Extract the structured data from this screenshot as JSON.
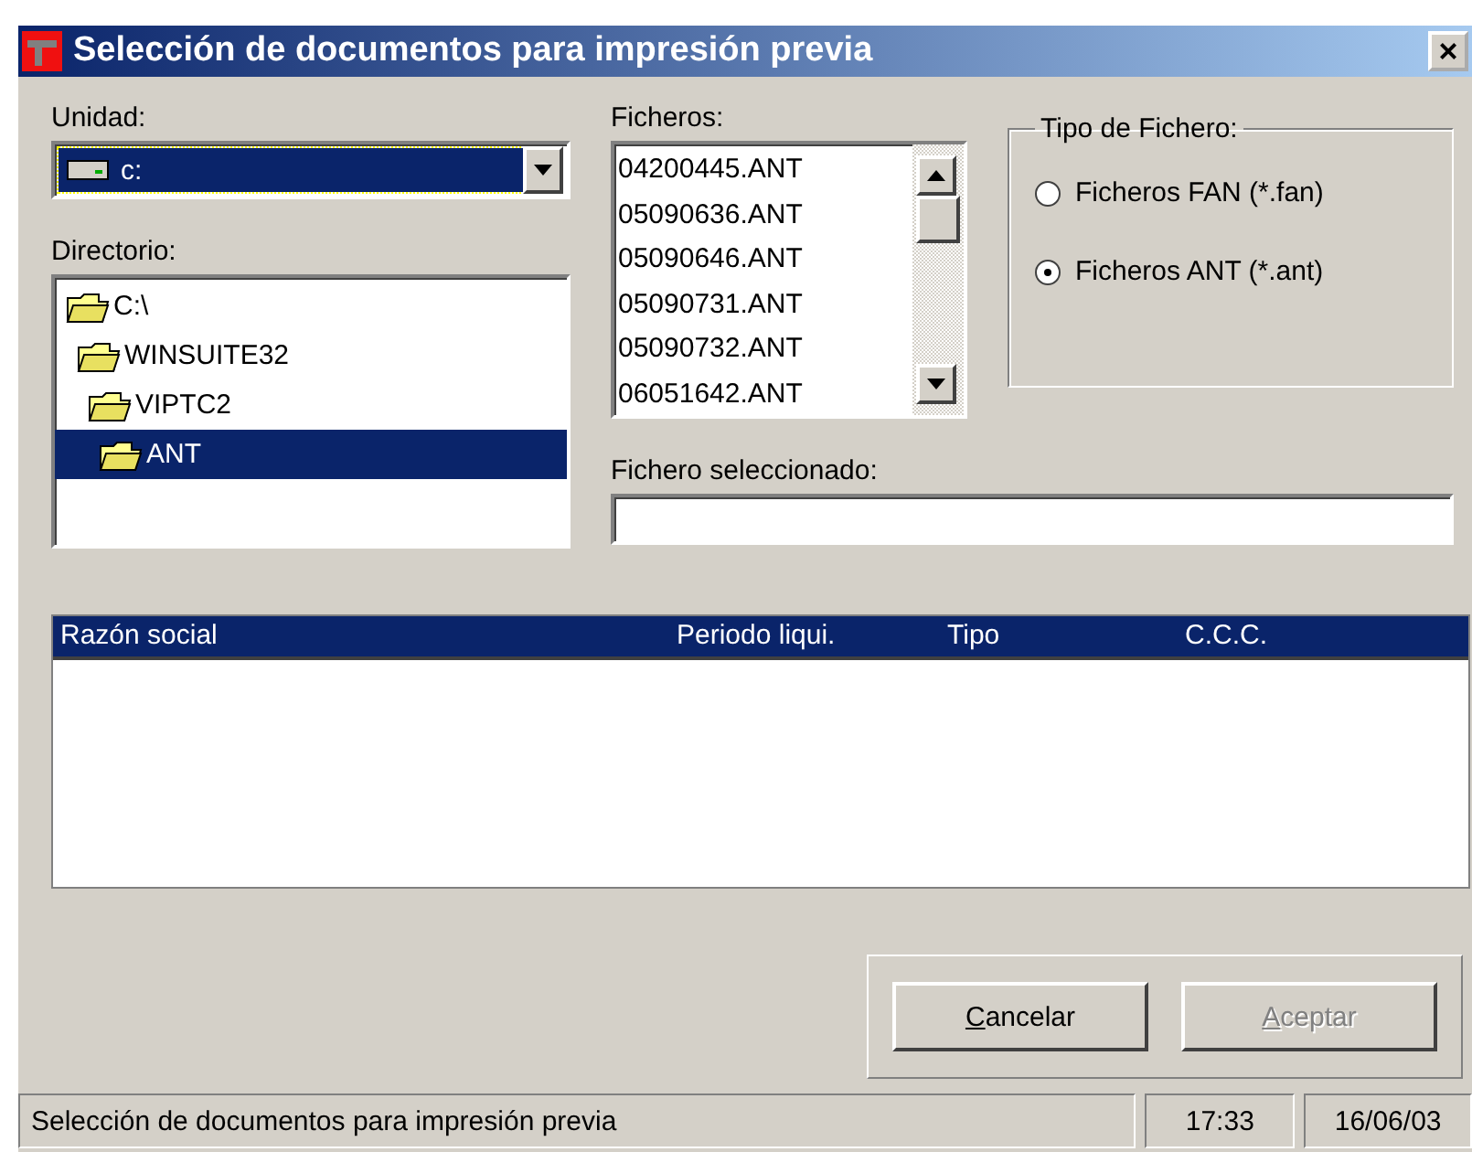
{
  "window": {
    "title": "Selección de documentos para impresión previa",
    "close": "×"
  },
  "drive": {
    "label": "Unidad:",
    "value": "c:",
    "selected": true
  },
  "directory": {
    "label": "Directorio:",
    "items": [
      {
        "name": "C:\\",
        "selected": false,
        "children": [
          {
            "name": "WINSUITE32",
            "selected": false,
            "children": [
              {
                "name": "VIPTC2",
                "selected": false,
                "children": [
                  {
                    "name": "ANT",
                    "selected": true
                  }
                ]
              }
            ]
          }
        ]
      }
    ]
  },
  "files": {
    "label": "Ficheros:",
    "items": [
      "04200445.ANT",
      "05090636.ANT",
      "05090646.ANT",
      "05090731.ANT",
      "05090732.ANT",
      "06051642.ANT"
    ]
  },
  "file_type": {
    "label": "Tipo de Fichero:",
    "options": [
      {
        "label": "Ficheros FAN (*.fan)",
        "selected": false
      },
      {
        "label": "Ficheros ANT (*.ant)",
        "selected": true
      }
    ]
  },
  "selected_file": {
    "label": "Fichero seleccionado:"
  },
  "table": {
    "columns": [
      "Razón social",
      "Periodo liqui.",
      "Tipo",
      "C.C.C."
    ]
  },
  "buttons": [
    {
      "label": "Cancelar",
      "disabled": false
    },
    {
      "label": "Aceptar",
      "disabled": true
    }
  ],
  "status_bar": {
    "message": "Selección de documentos para impresión previa",
    "time": "17:33",
    "date": "16/06/03"
  }
}
